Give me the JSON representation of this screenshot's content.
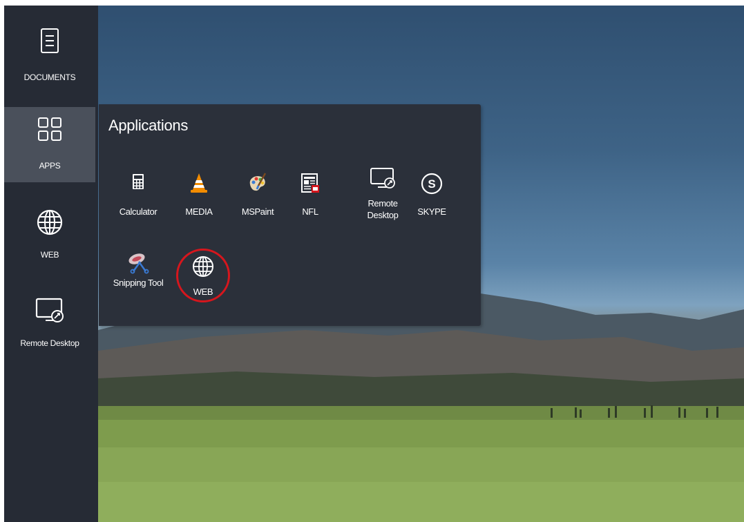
{
  "sidebar": {
    "items": [
      {
        "label": "DOCUMENTS",
        "icon": "document-icon"
      },
      {
        "label": "APPS",
        "icon": "apps-grid-icon",
        "active": true
      },
      {
        "label": "WEB",
        "icon": "globe-icon"
      },
      {
        "label": "Remote Desktop",
        "icon": "remote-desktop-icon"
      }
    ]
  },
  "panel": {
    "title": "Applications",
    "apps": [
      {
        "label": "Calculator",
        "icon": "calculator-icon"
      },
      {
        "label": "MEDIA",
        "icon": "vlc-cone-icon"
      },
      {
        "label": "MSPaint",
        "icon": "paint-palette-icon"
      },
      {
        "label": "NFL",
        "icon": "nfl-news-icon"
      },
      {
        "label": "Remote Desktop",
        "icon": "remote-desktop-icon"
      },
      {
        "label": "SKYPE",
        "icon": "skype-icon"
      },
      {
        "label": "Snipping Tool",
        "icon": "scissors-icon"
      },
      {
        "label": "WEB",
        "icon": "globe-icon",
        "highlighted": true
      }
    ]
  },
  "colors": {
    "sidebar_bg": "#262b35",
    "sidebar_active_bg": "#4a505b",
    "panel_bg": "#2b303a",
    "highlight_ring": "#d6161d",
    "text": "#ffffff"
  }
}
